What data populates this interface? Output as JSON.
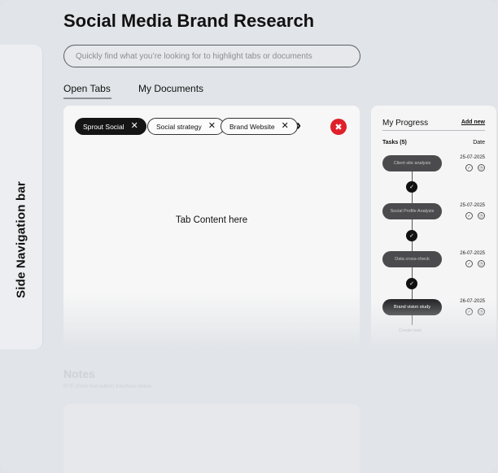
{
  "page": {
    "title": "Social Media Brand Research",
    "search_placeholder": "Quickly find what you’re looking for to highlight tabs or documents"
  },
  "sidebar": {
    "label": "Side Navigation bar"
  },
  "top_tabs": [
    {
      "label": "Open Tabs",
      "active": true
    },
    {
      "label": "My Documents",
      "active": false
    }
  ],
  "open_tabs": {
    "chips": [
      {
        "label": "Sprout Social",
        "selected": true
      },
      {
        "label": "Social strategy",
        "selected": false
      },
      {
        "label": "Brand Website",
        "selected": false
      }
    ],
    "close_glyph": "✕",
    "next_glyph": "›",
    "close_all_glyph": "✖",
    "content": "Tab Content here"
  },
  "progress": {
    "title": "My Progress",
    "add_new": "Add new",
    "tasks_header": "Tasks (5)",
    "date_header": "Date",
    "tasks": [
      {
        "label": "Client site analysis",
        "date": "25-07-2025"
      },
      {
        "label": "Social Profile Analysis",
        "date": "25-07-2025"
      },
      {
        "label": "Data cross-check",
        "date": "26-07-2025"
      },
      {
        "label": "Brand vision study",
        "date": "26-07-2025"
      }
    ],
    "create_task": "Create task",
    "check_glyph": "✓"
  },
  "notes": {
    "title": "Notes",
    "subtitle": "RTE (Rich text editor) Interface below"
  },
  "colors": {
    "background": "#e1e4e8",
    "accent_close": "#e0202a",
    "chip_dark": "#151515"
  }
}
